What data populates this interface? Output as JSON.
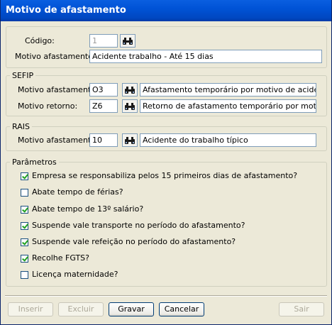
{
  "window": {
    "title": "Motivo de afastamento"
  },
  "main": {
    "codigo_label": "Código:",
    "codigo_value": "1",
    "motivo_label": "Motivo afastamento:",
    "motivo_value": "Acidente trabalho - Até 15 dias"
  },
  "sefip": {
    "legend": "SEFIP",
    "afastamento_label": "Motivo afastamento:",
    "afastamento_code": "O3",
    "afastamento_desc": "Afastamento temporário por motivo de acidente de",
    "retorno_label": "Motivo retorno:",
    "retorno_code": "Z6",
    "retorno_desc": "Retorno de afastamento temporário por motivo de a"
  },
  "rais": {
    "legend": "RAIS",
    "afastamento_label": "Motivo afastamento:",
    "afastamento_code": "10",
    "afastamento_desc": "Acidente do trabalho típico"
  },
  "parametros": {
    "legend": "Parâmetros",
    "items": [
      {
        "label": "Empresa se responsabiliza pelos 15 primeiros dias de afastamento?",
        "checked": true
      },
      {
        "label": "Abate tempo de férias?",
        "checked": false
      },
      {
        "label": "Abate tempo de 13º salário?",
        "checked": true
      },
      {
        "label": "Suspende vale transporte no período do afastamento?",
        "checked": true
      },
      {
        "label": "Suspende vale refeição no período do afastamento?",
        "checked": true
      },
      {
        "label": "Recolhe FGTS?",
        "checked": true
      },
      {
        "label": "Licença maternidade?",
        "checked": false
      }
    ]
  },
  "buttons": {
    "inserir": "Inserir",
    "excluir": "Excluir",
    "gravar": "Gravar",
    "cancelar": "Cancelar",
    "sair": "Sair"
  }
}
